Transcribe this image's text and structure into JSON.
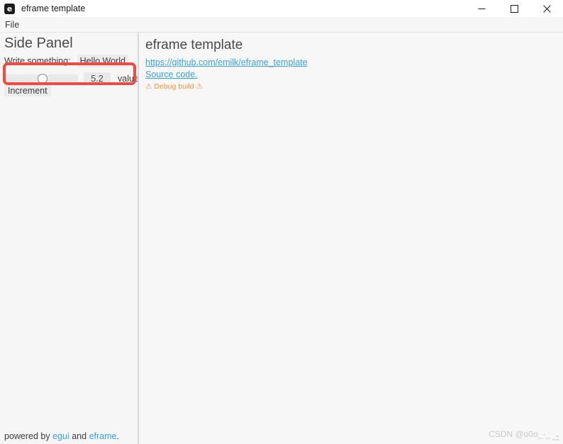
{
  "window": {
    "title": "eframe template",
    "icon_glyph": "e",
    "icon_name": "eframe-app-icon",
    "controls": {
      "minimize": "minimize-icon",
      "maximize": "maximize-icon",
      "close": "close-icon"
    }
  },
  "menubar": {
    "items": [
      {
        "label": "File"
      }
    ]
  },
  "side_panel": {
    "title": "Side Panel",
    "write_label": "Write something:",
    "write_value": "Hello World!",
    "write_placeholder": "",
    "slider": {
      "value_text": "5.2",
      "value_label": "value",
      "fraction": 0.52,
      "min": 0,
      "max": 10
    },
    "increment_label": "Increment",
    "footer": {
      "prefix": "powered by ",
      "link1": "egui",
      "middle": " and ",
      "link2": "eframe",
      "suffix": "."
    }
  },
  "central_panel": {
    "title": "eframe template",
    "url": "https://github.com/emilk/eframe_template",
    "source_link": "Source code.",
    "debug_build": {
      "warn_left": "⚠",
      "text": "Debug build",
      "warn_right": "⚠"
    }
  },
  "overlay": {
    "highlight_color": "#f04a43",
    "watermark": "CSDN @o0o_-_"
  },
  "colors": {
    "panel_bg": "#f6f6f6",
    "link": "#36a3f0",
    "warning": "#f59432",
    "text": "#3b3b3b"
  }
}
